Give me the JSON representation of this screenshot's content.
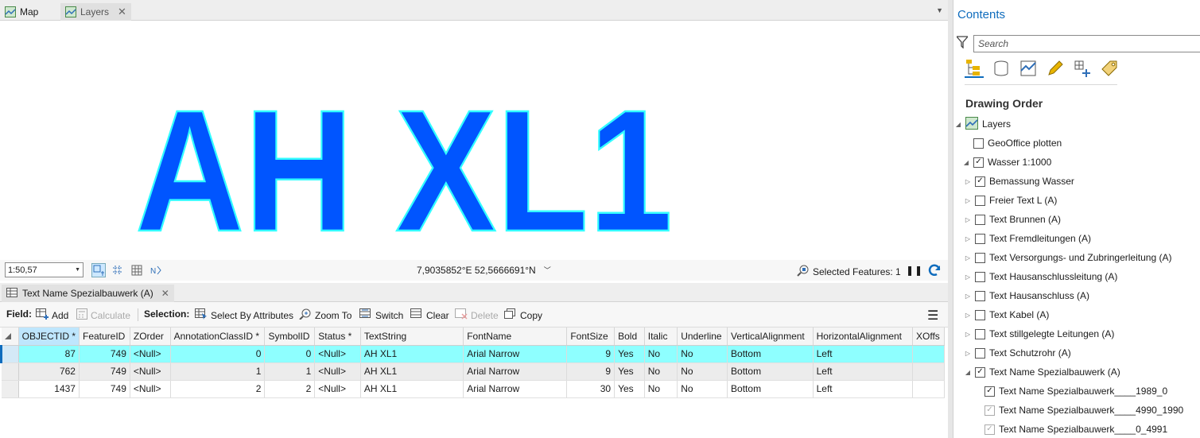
{
  "tabs": {
    "map": "Map",
    "layers": "Layers"
  },
  "map": {
    "label": "AH XL1",
    "fill": "#0055ff",
    "outline": "#33ffff"
  },
  "statusbar": {
    "scale": "1:50,57",
    "coordinates": "7,9035852°E 52,5666691°N",
    "selected_label": "Selected Features: 1"
  },
  "attr_tab": {
    "title": "Text Name Spezialbauwerk (A)"
  },
  "toolbar": {
    "field_label": "Field:",
    "add": "Add",
    "calculate": "Calculate",
    "selection_label": "Selection:",
    "select_by_attributes": "Select By Attributes",
    "zoom_to": "Zoom To",
    "switch": "Switch",
    "clear": "Clear",
    "delete": "Delete",
    "copy": "Copy"
  },
  "table": {
    "columns": [
      "OBJECTID *",
      "FeatureID",
      "ZOrder",
      "AnnotationClassID *",
      "SymbolID",
      "Status *",
      "TextString",
      "FontName",
      "FontSize",
      "Bold",
      "Italic",
      "Underline",
      "VerticalAlignment",
      "HorizontalAlignment",
      "XOffs"
    ],
    "rows": [
      [
        "87",
        "749",
        "<Null>",
        "0",
        "0",
        "<Null>",
        "AH XL1",
        "Arial Narrow",
        "9",
        "Yes",
        "No",
        "No",
        "Bottom",
        "Left",
        ""
      ],
      [
        "762",
        "749",
        "<Null>",
        "1",
        "1",
        "<Null>",
        "AH XL1",
        "Arial Narrow",
        "9",
        "Yes",
        "No",
        "No",
        "Bottom",
        "Left",
        ""
      ],
      [
        "1437",
        "749",
        "<Null>",
        "2",
        "2",
        "<Null>",
        "AH XL1",
        "Arial Narrow",
        "30",
        "Yes",
        "No",
        "No",
        "Bottom",
        "Left",
        ""
      ]
    ]
  },
  "contents": {
    "title": "Contents",
    "search_placeholder": "Search",
    "section": "Drawing Order",
    "tree": [
      {
        "label": "Layers",
        "level": 0,
        "expander": "expanded",
        "checkbox": "icon"
      },
      {
        "label": "GeoOffice plotten",
        "level": 1,
        "expander": "none",
        "checkbox": "unchecked"
      },
      {
        "label": "Wasser 1:1000",
        "level": 1,
        "expander": "expanded",
        "checkbox": "checked"
      },
      {
        "label": "Bemassung Wasser",
        "level": 2,
        "expander": "collapsed",
        "checkbox": "checked"
      },
      {
        "label": "Freier Text L (A)",
        "level": 2,
        "expander": "collapsed",
        "checkbox": "unchecked"
      },
      {
        "label": "Text Brunnen (A)",
        "level": 2,
        "expander": "collapsed",
        "checkbox": "unchecked"
      },
      {
        "label": "Text Fremdleitungen (A)",
        "level": 2,
        "expander": "collapsed",
        "checkbox": "unchecked"
      },
      {
        "label": "Text Versorgungs- und Zubringerleitung (A)",
        "level": 2,
        "expander": "collapsed",
        "checkbox": "unchecked"
      },
      {
        "label": "Text Hausanschlussleitung (A)",
        "level": 2,
        "expander": "collapsed",
        "checkbox": "unchecked"
      },
      {
        "label": "Text Hausanschluss (A)",
        "level": 2,
        "expander": "collapsed",
        "checkbox": "unchecked"
      },
      {
        "label": "Text Kabel (A)",
        "level": 2,
        "expander": "collapsed",
        "checkbox": "unchecked"
      },
      {
        "label": "Text stillgelegte Leitungen (A)",
        "level": 2,
        "expander": "collapsed",
        "checkbox": "unchecked"
      },
      {
        "label": "Text Schutzrohr  (A)",
        "level": 2,
        "expander": "collapsed",
        "checkbox": "unchecked"
      },
      {
        "label": "Text Name Spezialbauwerk (A)",
        "level": 2,
        "expander": "expanded",
        "checkbox": "checked"
      },
      {
        "label": "Text Name Spezialbauwerk____1989_0",
        "level": 3,
        "expander": "none",
        "checkbox": "checked"
      },
      {
        "label": "Text Name Spezialbauwerk____4990_1990",
        "level": 3,
        "expander": "none",
        "checkbox": "checked-disabled"
      },
      {
        "label": "Text Name Spezialbauwerk____0_4991",
        "level": 3,
        "expander": "none",
        "checkbox": "checked-disabled"
      }
    ]
  },
  "colors": {
    "accent": "#0f6cbd",
    "selected_row": "#8effff"
  }
}
